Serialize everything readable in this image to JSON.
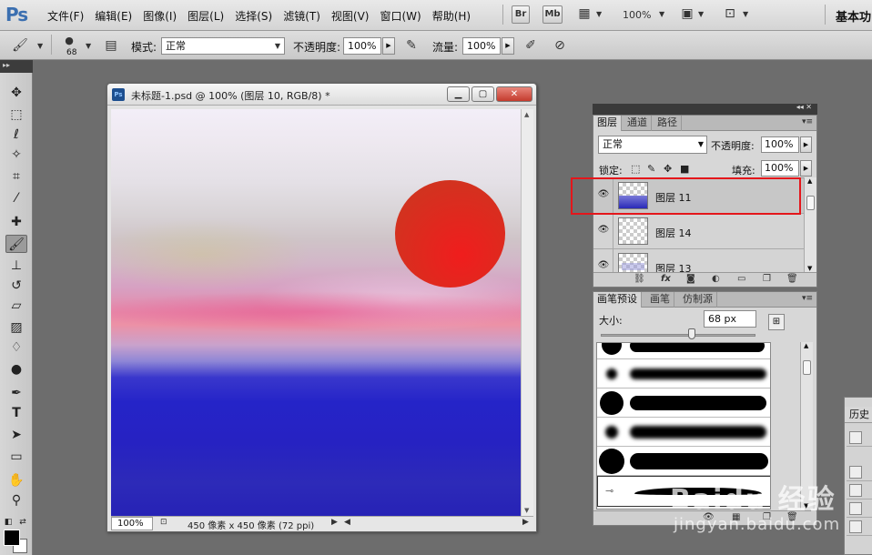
{
  "app": {
    "logo": "Ps",
    "menu": [
      "文件(F)",
      "编辑(E)",
      "图像(I)",
      "图层(L)",
      "选择(S)",
      "滤镜(T)",
      "视图(V)",
      "窗口(W)",
      "帮助(H)"
    ],
    "bridge_label": "Br",
    "minibridge_label": "Mb",
    "zoom": "100%",
    "workspace": "基本功"
  },
  "options": {
    "brush_size": "68",
    "mode_label": "模式:",
    "mode_value": "正常",
    "opacity_label": "不透明度:",
    "opacity_value": "100%",
    "flow_label": "流量:",
    "flow_value": "100%"
  },
  "document": {
    "title": "未标题-1.psd @ 100% (图层 10, RGB/8) *",
    "zoom": "100%",
    "status": "450 像素 x 450 像素 (72 ppi)"
  },
  "layers_panel": {
    "tabs": [
      "图层",
      "通道",
      "路径"
    ],
    "blend_mode": "正常",
    "opacity_label": "不透明度:",
    "opacity_value": "100%",
    "lock_label": "锁定:",
    "fill_label": "填充:",
    "fill_value": "100%",
    "layers": [
      {
        "name": "图层 11",
        "selected": true
      },
      {
        "name": "图层 14",
        "selected": false
      },
      {
        "name": "图层 13",
        "selected": false
      }
    ]
  },
  "brush_panel": {
    "tabs": [
      "画笔预设",
      "画笔",
      "仿制源"
    ],
    "size_label": "大小:",
    "size_value": "68 px"
  },
  "history_panel": {
    "tab": "历史"
  },
  "watermark": {
    "line1": "Baidu 经验",
    "line2": "jingyan.baidu.com"
  },
  "colors": {
    "highlight": "#e4161b",
    "foreground": "#000000",
    "background": "#ffffff"
  }
}
